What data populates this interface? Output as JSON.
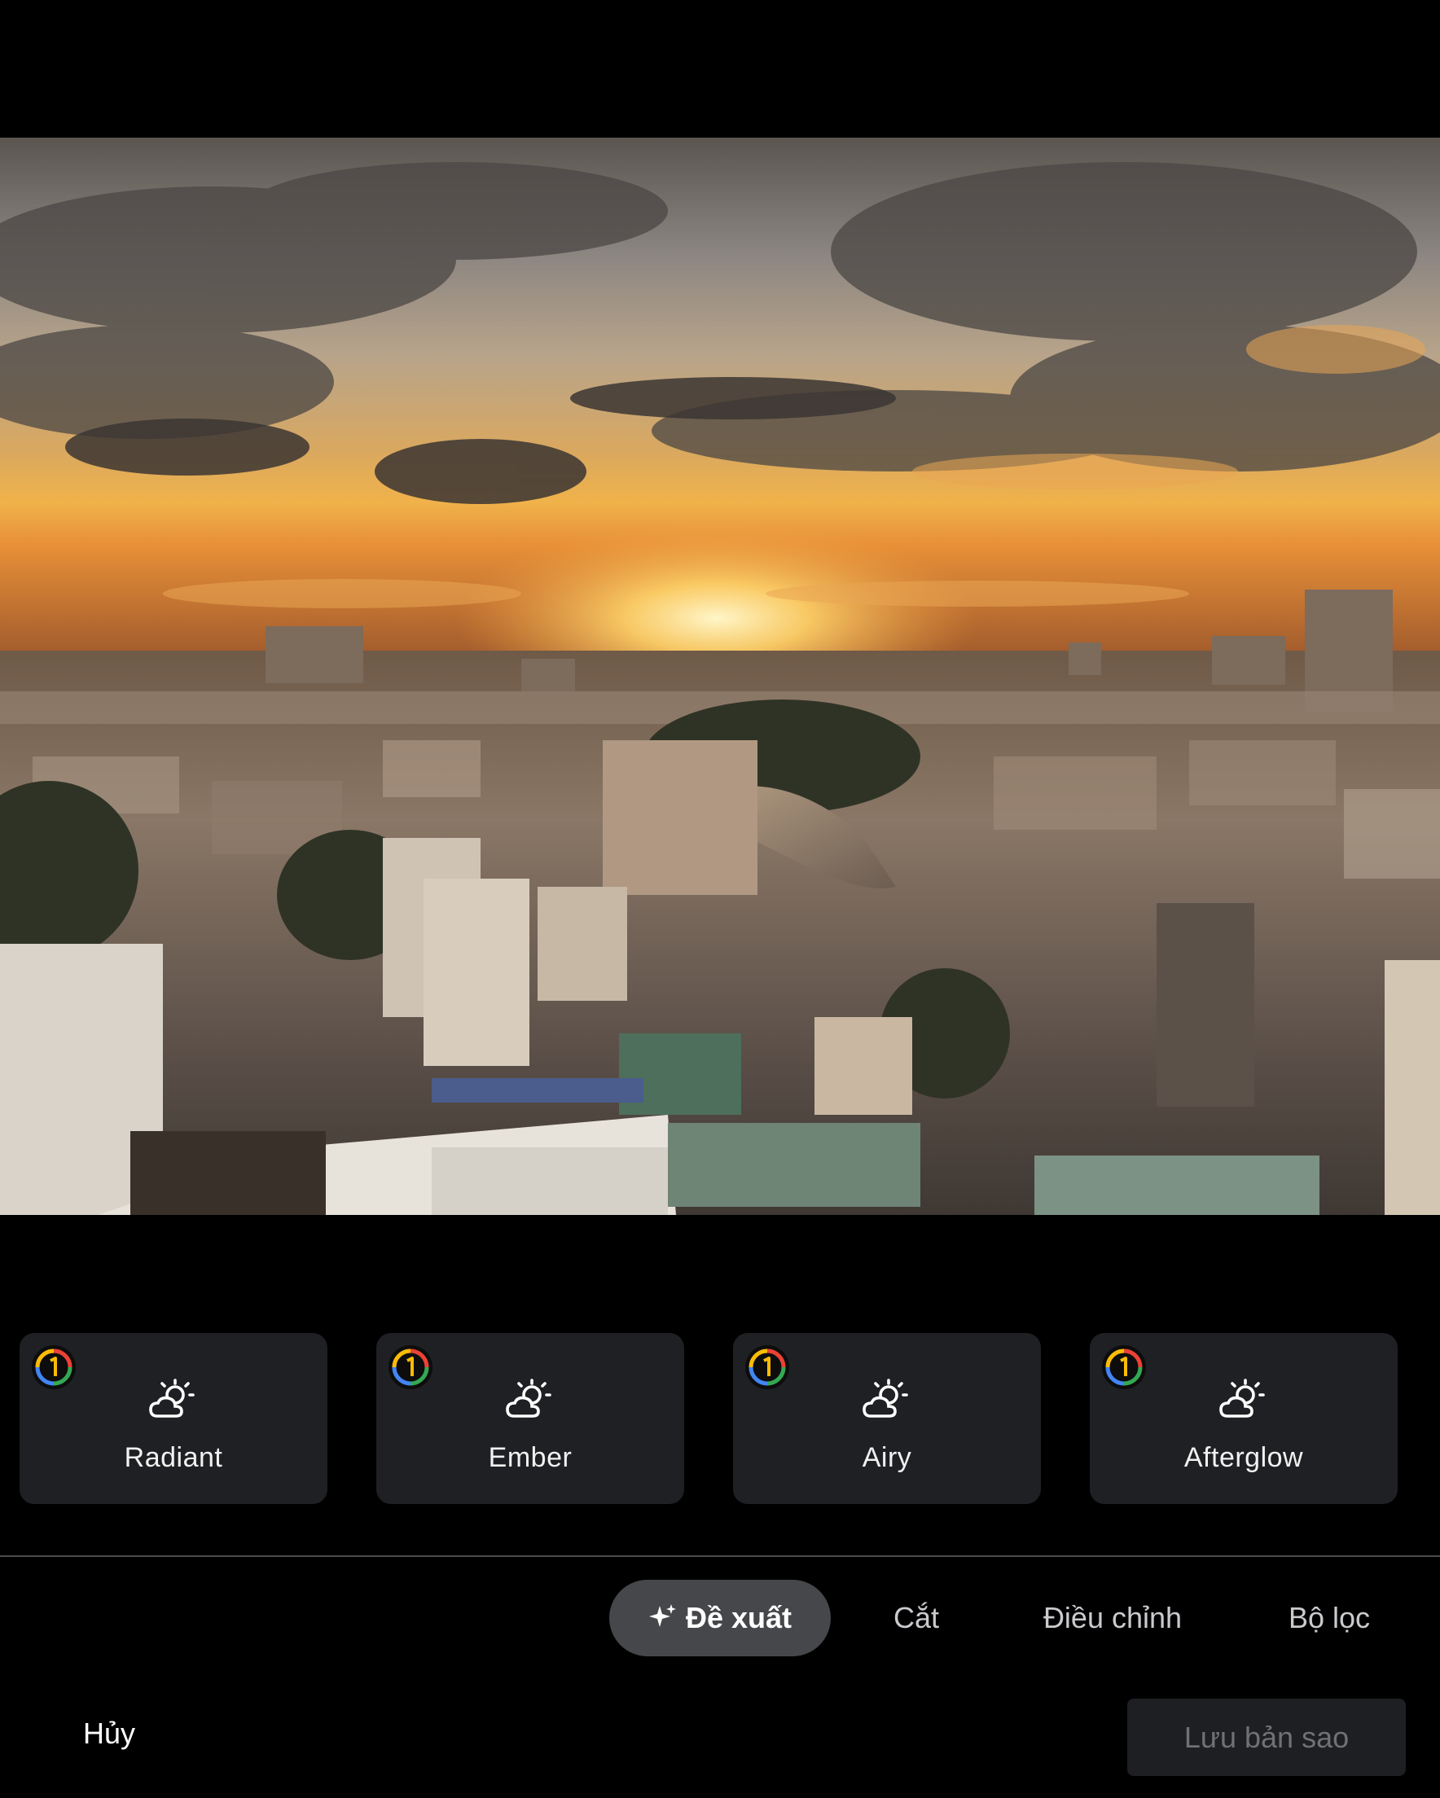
{
  "editor": {
    "suggestions": [
      {
        "label": "Radiant",
        "icon": "weather-sun-cloud-icon",
        "badge": "google-one-icon"
      },
      {
        "label": "Ember",
        "icon": "weather-sun-cloud-icon",
        "badge": "google-one-icon"
      },
      {
        "label": "Airy",
        "icon": "weather-sun-cloud-icon",
        "badge": "google-one-icon"
      },
      {
        "label": "Afterglow",
        "icon": "weather-sun-cloud-icon",
        "badge": "google-one-icon"
      }
    ],
    "tabs": [
      {
        "label": "Đề xuất",
        "active": true,
        "icon": "sparkle-icon"
      },
      {
        "label": "Cắt",
        "active": false
      },
      {
        "label": "Điều chỉnh",
        "active": false
      },
      {
        "label": "Bộ lọc",
        "active": false
      }
    ],
    "actions": {
      "cancel_label": "Hủy",
      "save_label": "Lưu bản sao"
    }
  },
  "colors": {
    "background": "#000000",
    "card_background": "#1f2023",
    "active_tab_background": "#46474b",
    "disabled_button_background": "#1e1f22",
    "disabled_text": "#6f7175"
  }
}
